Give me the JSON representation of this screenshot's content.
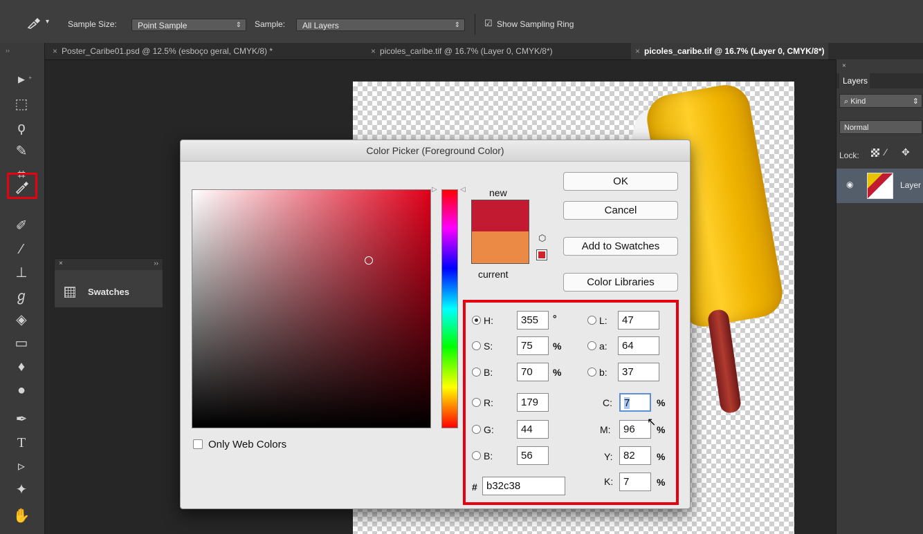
{
  "options_bar": {
    "sample_size_label": "Sample Size:",
    "sample_size_value": "Point Sample",
    "sample_label": "Sample:",
    "sample_value": "All Layers",
    "show_ring_label": "Show Sampling Ring",
    "show_ring_checked": true
  },
  "tabs": [
    {
      "label": "Poster_Caribe01.psd @ 12.5% (esboço geral, CMYK/8) *"
    },
    {
      "label": "picoles_caribe.tif @ 16.7% (Layer 0, CMYK/8*)"
    },
    {
      "label": "picoles_caribe.tif @ 16.7% (Layer 0, CMYK/8*)",
      "active": true
    }
  ],
  "toolbar": {
    "selected_tool": "eyedropper",
    "tools": [
      "move-icon",
      "marquee-icon",
      "lasso-icon",
      "quick-select-icon",
      "crop-icon",
      "eyedropper-icon",
      "healing-brush-icon",
      "brush-icon",
      "clone-stamp-icon",
      "history-brush-icon",
      "eraser-icon",
      "gradient-icon",
      "blur-icon",
      "dodge-icon",
      "pen-icon",
      "type-icon",
      "path-select-icon",
      "shape-icon",
      "hand-icon"
    ]
  },
  "swatches_panel": {
    "label": "Swatches"
  },
  "layers_panel": {
    "tab": "Layers",
    "filter": "Kind",
    "blend_mode": "Normal",
    "lock_label": "Lock:",
    "layer_name": "Layer"
  },
  "dialog": {
    "title": "Color Picker (Foreground Color)",
    "ok": "OK",
    "cancel": "Cancel",
    "add_swatches": "Add to Swatches",
    "color_libraries": "Color Libraries",
    "new_label": "new",
    "current_label": "current",
    "only_web_colors": "Only Web Colors",
    "new_color": "#c21a30",
    "current_color": "#ea8a45",
    "fields": {
      "H": {
        "label": "H:",
        "value": "355",
        "unit": "°",
        "selected": true
      },
      "S": {
        "label": "S:",
        "value": "75",
        "unit": "%"
      },
      "B": {
        "label": "B:",
        "value": "70",
        "unit": "%"
      },
      "R": {
        "label": "R:",
        "value": "179"
      },
      "G": {
        "label": "G:",
        "value": "44"
      },
      "Bl": {
        "label": "B:",
        "value": "56"
      },
      "L": {
        "label": "L:",
        "value": "47"
      },
      "a": {
        "label": "a:",
        "value": "64"
      },
      "b": {
        "label": "b:",
        "value": "37"
      },
      "C": {
        "label": "C:",
        "value": "7",
        "unit": "%"
      },
      "M": {
        "label": "M:",
        "value": "96",
        "unit": "%"
      },
      "Y": {
        "label": "Y:",
        "value": "82",
        "unit": "%"
      },
      "K": {
        "label": "K:",
        "value": "7",
        "unit": "%"
      }
    },
    "hex_label": "#",
    "hex_value": "b32c38"
  }
}
